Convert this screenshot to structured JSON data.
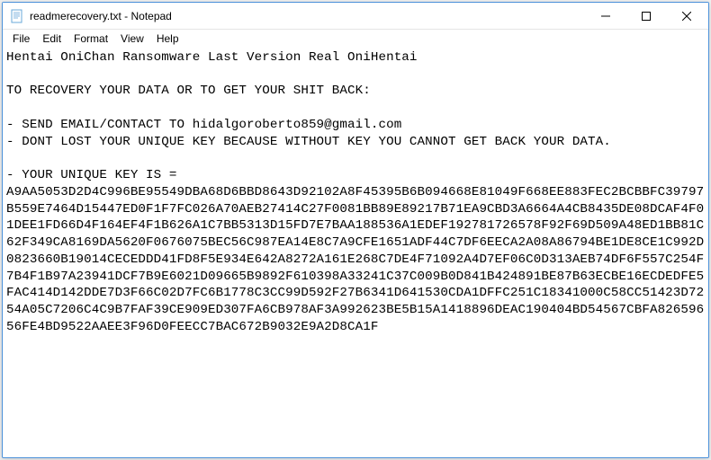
{
  "titlebar": {
    "filename": "readmerecovery.txt",
    "appname": "Notepad",
    "full_title": "readmerecovery.txt - Notepad"
  },
  "window_controls": {
    "minimize": "—",
    "maximize": "☐",
    "close": "✕"
  },
  "menubar": {
    "file": "File",
    "edit": "Edit",
    "format": "Format",
    "view": "View",
    "help": "Help"
  },
  "document": {
    "line1": "Hentai OniChan Ransomware Last Version Real OniHentai",
    "line2": "",
    "line3": "TO RECOVERY YOUR DATA OR TO GET YOUR SHIT BACK:",
    "line4": "",
    "line5": "- SEND EMAIL/CONTACT TO hidalgoroberto859@gmail.com",
    "line6": "- DONT LOST YOUR UNIQUE KEY BECAUSE WITHOUT KEY YOU CANNOT GET BACK YOUR DATA.",
    "line7": "",
    "line8": "- YOUR UNIQUE KEY IS =",
    "key_block": "A9AA5053D2D4C996BE95549DBA68D6BBD8643D92102A8F45395B6B094668E81049F668EE883FEC2BCBBFC39797B559E7464D15447ED0F1F7FC026A70AEB27414C27F0081BB89E89217B71EA9CBD3A6664A4CB8435DE08DCAF4F01DEE1FD66D4F164EF4F1B626A1C7BB5313D15FD7E7BAA188536A1EDEF192781726578F92F69D509A48ED1BB81C62F349CA8169DA5620F0676075BEC56C987EA14E8C7A9CFE1651ADF44C7DF6EECA2A08A86794BE1DE8CE1C992D0823660B19014CECEDDD41FD8F5E934E642A8272A161E268C7DE4F71092A4D7EF06C0D313AEB74DF6F557C254F7B4F1B97A23941DCF7B9E6021D09665B9892F610398A33241C37C009B0D841B424891BE87B63ECBE16ECDEDFE5FAC414D142DDE7D3F66C02D7FC6B1778C3CC99D592F27B6341D641530CDA1DFFC251C18341000C58CC51423D7254A05C7206C4C9B7FAF39CE909ED307FA6CB978AF3A992623BE5B15A1418896DEAC190404BD54567CBFA82659656FE4BD9522AAEE3F96D0FEECC7BAC672B9032E9A2D8CA1F"
  }
}
